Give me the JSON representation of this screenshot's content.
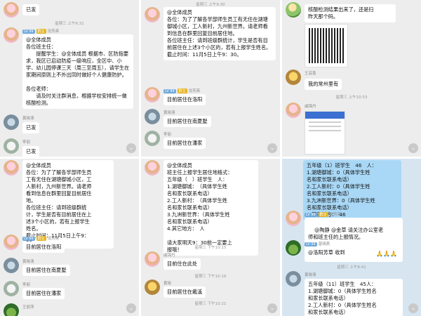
{
  "colors": {
    "panel_bg": "#ededed",
    "panel_bg_alt": "#d7e5f0",
    "bubble": "#ffffff",
    "bubble_blue": "#a9d8f6",
    "level_tag": "#6fa8dc",
    "role_tag": "#e6b422"
  },
  "tags": {
    "level": "LV 99",
    "teacher": "群主"
  },
  "p1": {
    "top_bubble": "已发",
    "time1": "星期三 上午6:31",
    "sender1": "沈芳英",
    "notice": "@全体成员\n各位班主任：\n　　提醒学生：@全体成员 根据市、区防指要求，我区已启动防疫一级响应，全区中、小学、幼儿园停课三天（周三至周五），请学生在家期间原则上不外出同时做好个人健康防护。\n\n各位老师：\n　　请及时关注群消息，根据学校安排统一做核酸检测。",
    "sender2": "黄晓清",
    "reply1": "已发",
    "sender3": "李丽",
    "reply2": "已发"
  },
  "p2": {
    "time1": "星期三 上午9:30",
    "notice": "@全体成员\n各位：为了了解各学部师生员工有无住在湖塘御城小区，工人新村，九州新世界。请老师看到信息在群里回复目前居住地。\n各位班主任：请到班级群统计，学生是否有目前居住在上述3个小区的，若有上报学生姓名。\n截止时间：11月5日上午9：30。",
    "sender1": "沈芳英",
    "msg1": "目前居住在洛阳",
    "sender2": "黄晓清",
    "msg2": "目前居住在南夏墅",
    "sender3": "李丽",
    "msg3": "目前居住在潘家"
  },
  "p3": {
    "msg1": "核酸检测结果出来了，还是扫\n昨天那个码。",
    "sender1": "王芸香",
    "msg2": "我的常州里有",
    "time1": "星期三 上午10:53",
    "sender2": "戚锦丹"
  },
  "p4": {
    "notice": "@全体成员\n各位：为了了解各学部师生员\n工有无住在湖塘御城小区，工\n人新村，九州新世界。请老师\n看到信息在群里回复目前居住\n地。\n各位班主任：请到班级群统\n计，学生是否有目前居住在上\n述3个小区的，若有上报学生\n姓名。\n截止时间：11月5日上午9：\n30。",
    "sender1": "沈芳英",
    "msg1": "目前居住在洛阳",
    "sender2": "黄晓清",
    "msg2": "目前居住在南夏墅",
    "sender3": "李丽",
    "msg3": "目前居住在潘家",
    "sender4": "王丽萍"
  },
  "p5": {
    "notice": "@全体成员\n班主任上报学生居住地格式：\n五年级（　）班学生　人：\n1.湖塘御城：　（具体学生姓\n名和家长联系电话）\n2.工人新村：　（具体学生姓\n名和家长联系电话）\n3.九洲新世界：（具体学生姓\n名和家长联系电话）\n4.其它地方：　人\n\n请大家明天9：30前一定要上\n报哦！",
    "time1": "星期三 下午10:15",
    "sender1": "戚锦丹",
    "msg1": "目前住在此处",
    "time2": "星期三 下午10:16",
    "sender2": "黄晓",
    "msg2": "目前居住在戴溪",
    "time3": "星期三 下午10:21"
  },
  "p6": {
    "report1": "五年级（1）班学生　46　人：\n1.湖塘御城：0（具体学生姓\n名和家长联系电话）\n2.工人新村：0（具体学生姓\n名和家长联系电话）\n3.九洲新世界：0（具体学生姓\n名和家长联系电话）\n4.其它地方：　46",
    "sender1": "沈芳英",
    "msg1": "@陶静 @金草 请关注办公室老\n师和班主任的上报情况。",
    "msg1_emoji": "🙏🙏🙏",
    "sender2": "曾靖燕",
    "msg2": "@洛阳芳草 收到",
    "time1": "星期三 上午8:41",
    "sender3": "黄晓清",
    "report2": "五年级（11）班学生　45人：\n1.湖塘御城：0（具体学生姓名\n和家长联系电话）\n2.工人新村：0（具体学生姓名\n和家长联系电话）\n3.九洲新世界：0（具体学生姓名"
  },
  "icons": {
    "scroll": "chevron-down-icon"
  }
}
